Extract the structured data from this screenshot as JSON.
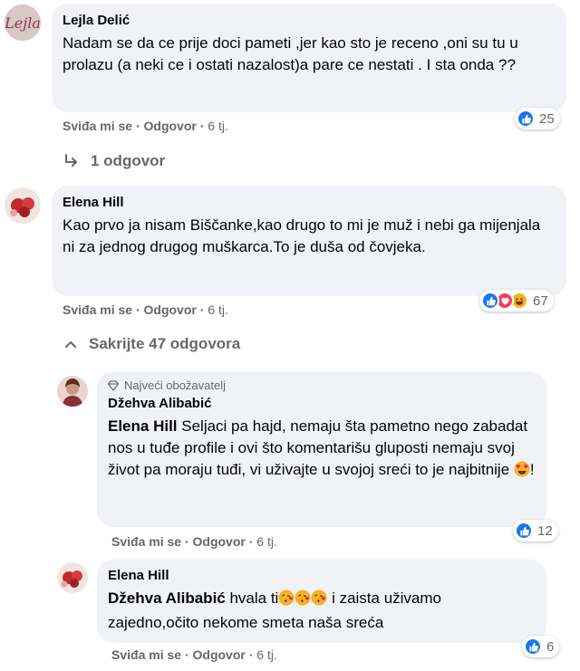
{
  "comments": [
    {
      "author": "Lejla Delić",
      "text": "Nadam se da ce prije doci pameti ,jer kao sto je receno ,oni su tu u prolazu (a neki ce i ostati nazalost)a pare ce nestati . I sta onda ??",
      "like_label": "Sviđa mi se",
      "reply_label": "Odgovor",
      "time": "6 tj.",
      "reaction_count": "25",
      "reactions": [
        "like"
      ]
    },
    {
      "author": "Elena Hill",
      "text": "Kao prvo ja nisam Biščanke,kao drugo to mi je muž i nebi ga mijenjala ni za jednog drugog muškarca.To je duša od čovjeka.",
      "like_label": "Sviđa mi se",
      "reply_label": "Odgovor",
      "time": "6 tj.",
      "reaction_count": "67",
      "reactions": [
        "like",
        "love",
        "haha"
      ]
    }
  ],
  "replies_toggle_1": "1 odgovor",
  "replies_toggle_2": "Sakrijte 47 odgovora",
  "replies": [
    {
      "badge": "Najveći obožavatelj",
      "author": "Džehva Alibabić",
      "mention": "Elena Hill",
      "text": " Seljaci pa hajd, nemaju šta pametno nego zabadat nos u tuđe profile i ovi što komentarišu gluposti nemaju svoj život pa moraju tuđi, vi uživajte u svojoj sreći to je najbitnije ",
      "text_end": "!",
      "like_label": "Sviđa mi se",
      "reply_label": "Odgovor",
      "time": "6 tj.",
      "reaction_count": "12",
      "reactions": [
        "like"
      ]
    },
    {
      "author": "Elena Hill",
      "mention": "Džehva Alibabić",
      "text_a": " hvala ti",
      "text_b": " i zaista uživamo zajedno,očito nekome smeta naša sreća",
      "like_label": "Sviđa mi se",
      "reply_label": "Odgovor",
      "time": "6 tj.",
      "reaction_count": "6",
      "reactions": [
        "like"
      ]
    }
  ],
  "separator": "·",
  "icons": {
    "reply_arrow": "reply-arrow-icon",
    "chevron_up": "chevron-up-icon",
    "diamond": "diamond-icon",
    "like": "like-reaction-icon",
    "love": "love-reaction-icon",
    "haha": "haha-reaction-icon",
    "heart_eyes": "heart-eyes-emoji",
    "kiss": "blowing-kiss-emoji"
  },
  "colors": {
    "bubble": "#f0f2f5",
    "secondary_text": "#65676b",
    "like_blue": "#1877f2",
    "love_red": "#f33e58",
    "haha_yellow": "#f7b125"
  }
}
